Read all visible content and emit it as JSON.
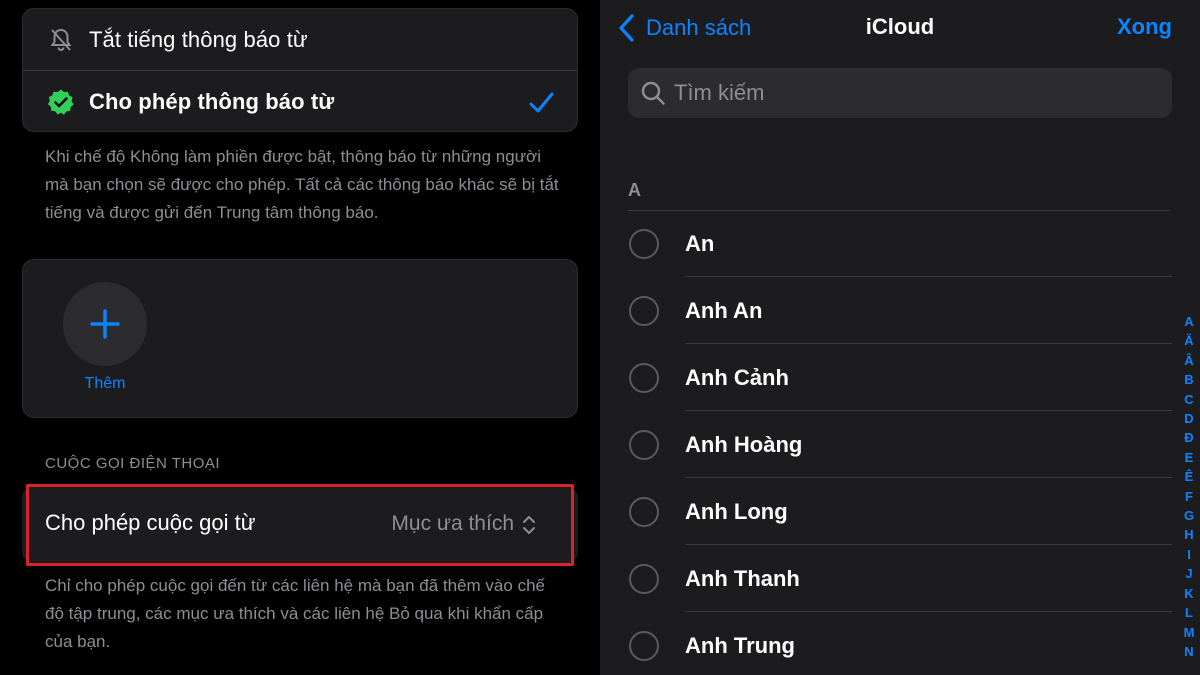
{
  "focus_settings": {
    "notify_options": [
      {
        "label": "Tắt tiếng thông báo từ",
        "selected": false
      },
      {
        "label": "Cho phép thông báo từ",
        "selected": true
      }
    ],
    "notify_footer": "Khi chế độ Không làm phiền được bật, thông báo từ những người mà bạn chọn sẽ được cho phép. Tất cả các thông báo khác sẽ bị tắt tiếng và được gửi đến Trung tâm thông báo.",
    "add_label": "Thêm",
    "calls_section_header": "CUỘC GỌI ĐIỆN THOẠI",
    "calls_row": {
      "label": "Cho phép cuộc gọi từ",
      "value": "Mục ưa thích"
    },
    "calls_footer": "Chỉ cho phép cuộc gọi đến từ các liên hệ mà bạn đã thêm vào chế độ tập trung, các mục ưa thích và các liên hệ Bỏ qua khi khẩn cấp của bạn.",
    "highlight_color": "#d8232a"
  },
  "contacts_picker": {
    "back_label": "Danh sách",
    "title": "iCloud",
    "done_label": "Xong",
    "search_placeholder": "Tìm kiếm",
    "section_letter": "A",
    "contacts": [
      "An",
      "Anh An",
      "Anh Cảnh",
      "Anh Hoàng",
      "Anh Long",
      "Anh Thanh",
      "Anh Trung"
    ],
    "index_letters": [
      "A",
      "Ă",
      "Â",
      "B",
      "C",
      "D",
      "Đ",
      "E",
      "Ê",
      "F",
      "G",
      "H",
      "I",
      "J",
      "K",
      "L",
      "M",
      "N"
    ]
  },
  "colors": {
    "accent": "#0a84ff",
    "check_badge": "#30d158",
    "background": "#000000",
    "card": "#1c1c1e"
  }
}
